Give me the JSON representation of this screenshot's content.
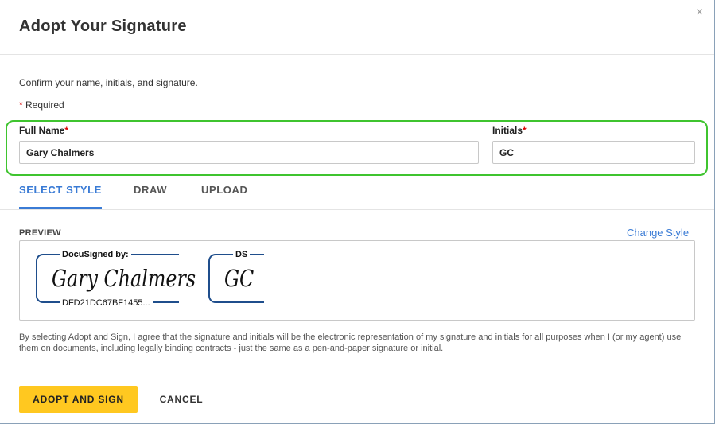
{
  "dialog": {
    "title": "Adopt Your Signature",
    "close_glyph": "×"
  },
  "form": {
    "intro": "Confirm your name, initials, and signature.",
    "required_marker": "*",
    "required_text": " Required",
    "full_name_label": "Full Name",
    "full_name_value": "Gary Chalmers",
    "initials_label": "Initials",
    "initials_value": "GC"
  },
  "tabs": [
    {
      "label": "SELECT STYLE",
      "active": true
    },
    {
      "label": "DRAW",
      "active": false
    },
    {
      "label": "UPLOAD",
      "active": false
    }
  ],
  "preview": {
    "label": "PREVIEW",
    "change_style": "Change Style",
    "signature_header": "DocuSigned by:",
    "signature_script": "Gary Chalmers",
    "signature_id": "DFD21DC67BF1455...",
    "initials_header": "DS",
    "initials_script": "GC"
  },
  "legal_text": "By selecting Adopt and Sign, I agree that the signature and initials will be the electronic representation of my signature and initials for all purposes when I (or my agent) use them on documents, including legally binding contracts - just the same as a pen-and-paper signature or initial.",
  "actions": {
    "adopt_label": "ADOPT AND SIGN",
    "cancel_label": "CANCEL"
  },
  "colors": {
    "accent": "#3a7bd5",
    "primary_button": "#ffc820",
    "highlight_outline": "#3fc42f",
    "bracket": "#1f4e8c",
    "required": "#dd0000"
  }
}
